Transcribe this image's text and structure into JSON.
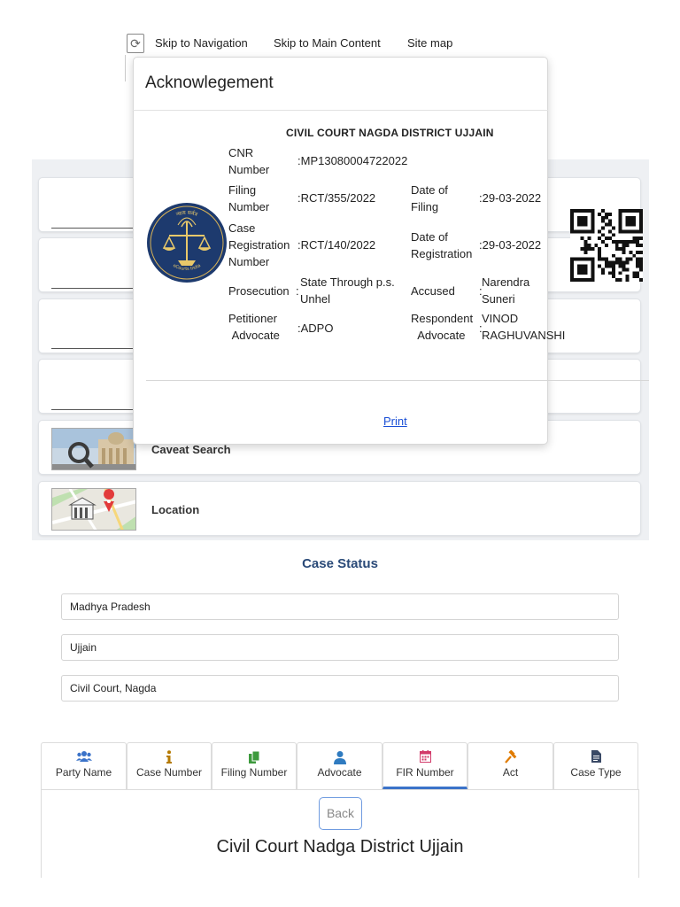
{
  "skip_nav": {
    "icon": "refresh-icon",
    "links": [
      "Skip to Navigation",
      "Skip to Main Content",
      "Site map"
    ]
  },
  "services": {
    "caveat_label": "Caveat Search",
    "location_label": "Location"
  },
  "modal": {
    "title": "Acknowlegement",
    "court_heading": "CIVIL COURT NAGDA DISTRICT UJJAIN",
    "emblem_caption": "eCourts India",
    "emblem_motto": "न्याय सर्वत्र",
    "fields": {
      "cnr_label": [
        "CNR",
        "Number"
      ],
      "cnr_value": ":MP13080004722022",
      "filing_no_label": [
        "Filing",
        "Number"
      ],
      "filing_no_value": ":RCT/355/2022",
      "filing_date_label": [
        "Date of",
        "Filing"
      ],
      "filing_date_value": ":29-03-2022",
      "reg_no_label": [
        "Case",
        "Registration",
        "Number"
      ],
      "reg_no_value": ":RCT/140/2022",
      "reg_date_label": [
        "Date of",
        "Registration"
      ],
      "reg_date_value": ":29-03-2022",
      "prosecution_label": "Prosecution",
      "prosecution_sep": ":",
      "prosecution_value": [
        "State Through p.s.",
        "Unhel"
      ],
      "accused_label": "Accused",
      "accused_sep": ":",
      "accused_value": [
        "Narendra",
        "Suneri"
      ],
      "pet_adv_label": [
        "Petitioner",
        "Advocate"
      ],
      "pet_adv_value": ":ADPO",
      "resp_adv_label": [
        "Respondent",
        "Advocate"
      ],
      "resp_adv_sep": ":",
      "resp_adv_value": [
        "VINOD",
        "RAGHUVANSHI"
      ]
    },
    "print_label": "Print"
  },
  "case_status": {
    "title": "Case Status",
    "state": "Madhya Pradesh",
    "district": "Ujjain",
    "court": "Civil Court, Nagda"
  },
  "tabs": [
    {
      "label": "Party Name",
      "icon": "users-icon",
      "color": "#3b73c9"
    },
    {
      "label": "Case Number",
      "icon": "info-icon",
      "color": "#b57a00"
    },
    {
      "label": "Filing Number",
      "icon": "files-icon",
      "color": "#3c9a3c"
    },
    {
      "label": "Advocate",
      "icon": "user-icon",
      "color": "#2f7bc0"
    },
    {
      "label": "FIR Number",
      "icon": "calendar-icon",
      "color": "#d23a6a"
    },
    {
      "label": "Act",
      "icon": "gavel-icon",
      "color": "#e07b00"
    },
    {
      "label": "Case Type",
      "icon": "document-icon",
      "color": "#3a4a66"
    }
  ],
  "active_tab": "FIR Number",
  "back_label": "Back",
  "court_name": "Civil Court Nadga District Ujjain"
}
